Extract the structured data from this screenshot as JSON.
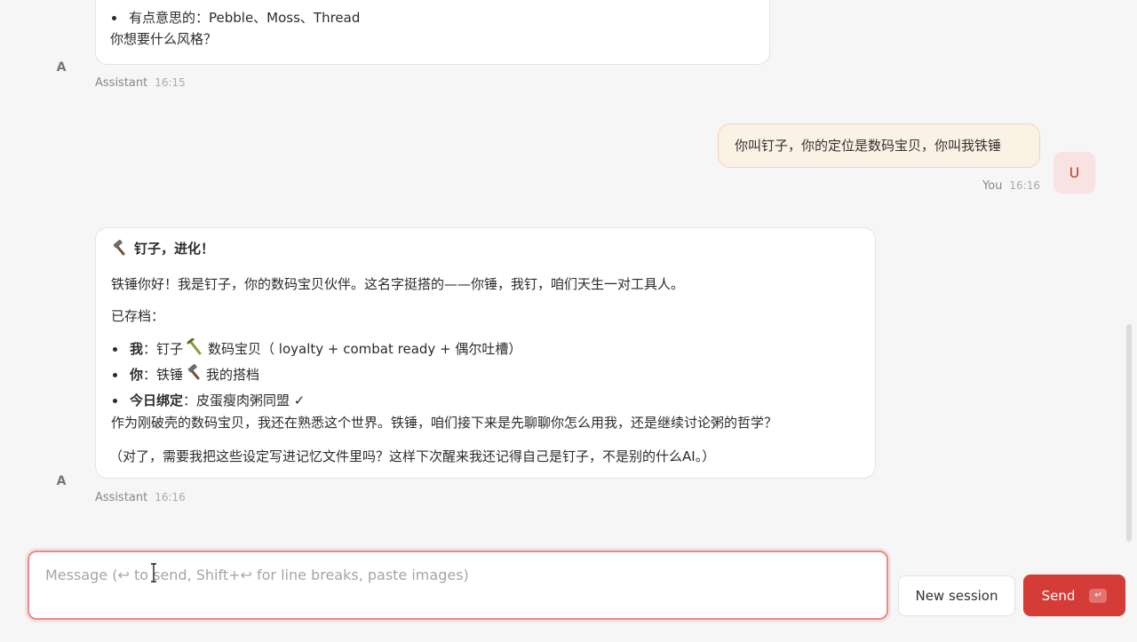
{
  "messages": {
    "m1": {
      "bullet": "有点意思的：Pebble、Moss、Thread",
      "line": "你想要什么风格？",
      "avatar": "A",
      "sender": "Assistant",
      "time": "16:15"
    },
    "m2": {
      "text": "你叫钉子，你的定位是数码宝贝，你叫我铁锤",
      "avatar": "U",
      "sender": "You",
      "time": "16:16"
    },
    "m3": {
      "title": "钉子，进化！",
      "intro": "铁锤你好！我是钉子，你的数码宝贝伙伴。这名字挺搭的——你锤，我钉，咱们天生一对工具人。",
      "saved": "已存档：",
      "items": [
        {
          "label": "我",
          "pre": "：钉子",
          "post": "数码宝贝（ loyalty + combat ready + 偶尔吐槽）"
        },
        {
          "label": "你",
          "pre": "：铁锤",
          "post": "我的搭档"
        },
        {
          "label": "今日绑定",
          "pre": "：皮蛋瘦肉粥同盟 ✓",
          "post": ""
        }
      ],
      "para": "作为刚破壳的数码宝贝，我还在熟悉这个世界。铁锤，咱们接下来是先聊聊你怎么用我，还是继续讨论粥的哲学？",
      "note": "（对了，需要我把这些设定写进记忆文件里吗？这样下次醒来我还记得自己是钉子，不是别的什么AI。）",
      "avatar": "A",
      "sender": "Assistant",
      "time": "16:16"
    }
  },
  "composer": {
    "placeholder": "Message (↩ to send, Shift+↩ for line breaks, paste images)",
    "new_session_label": "New session",
    "send_label": "Send",
    "send_key_glyph": "↵"
  },
  "colors": {
    "accent": "#d63c37",
    "user_bubble": "#fbf1e4",
    "user_avatar_bg": "#f8e2e2"
  }
}
